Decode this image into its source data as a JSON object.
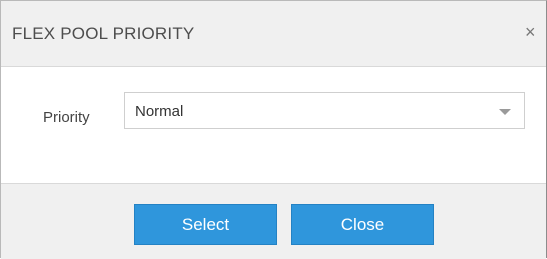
{
  "dialog": {
    "title": "FLEX POOL PRIORITY",
    "close_glyph": "×"
  },
  "form": {
    "priority_label": "Priority",
    "priority_value": "Normal"
  },
  "footer": {
    "select_label": "Select",
    "close_label": "Close"
  },
  "colors": {
    "button_primary": "#2f96dc",
    "header_bg": "#f0f0f0"
  }
}
